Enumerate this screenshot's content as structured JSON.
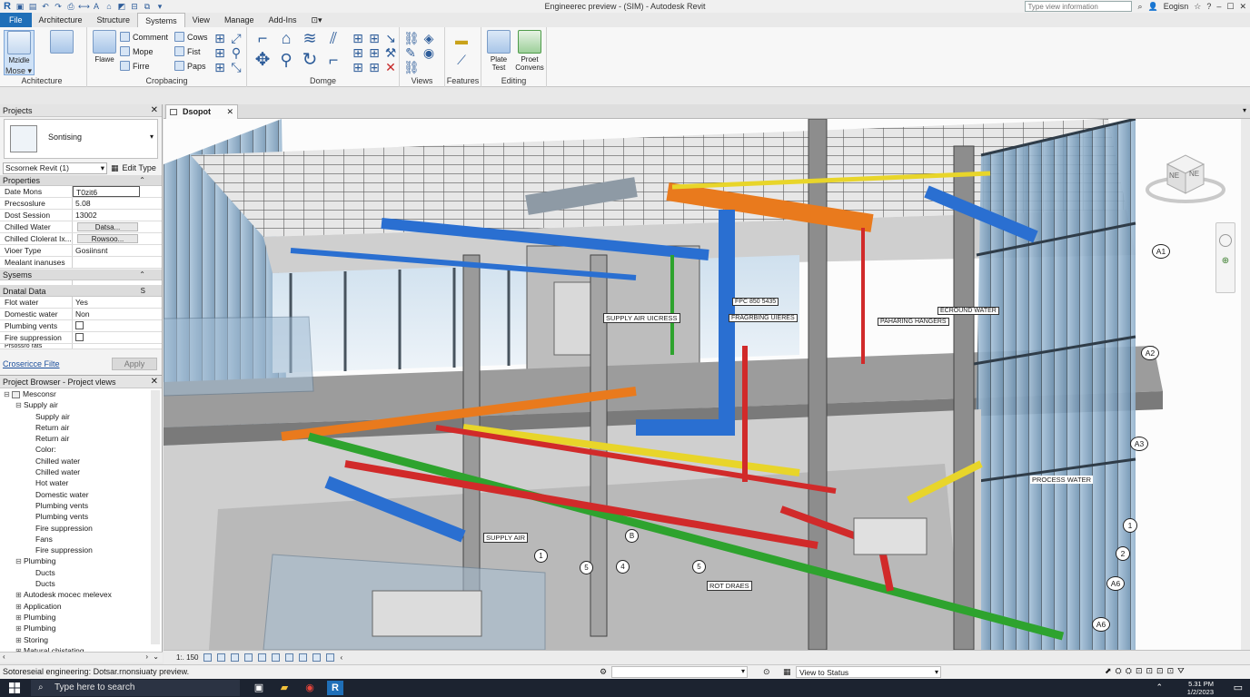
{
  "app": {
    "title": "Engineerec preview - (SIM) - Autodesk Revit",
    "search_placeholder": "Type view information",
    "user": "Eogisn"
  },
  "tabs": [
    "File",
    "Architecture",
    "Structure",
    "Systems",
    "View",
    "Manage",
    "Add-Ins"
  ],
  "active_tab": "Systems",
  "ribbon": {
    "modify": {
      "label": "Mzidle",
      "dropdown": "Mose"
    },
    "architecture": {
      "label": "Achitecture"
    },
    "group1": {
      "flawe": "Flawe",
      "items": [
        "Comment",
        "Mope",
        "Firre"
      ],
      "items2": [
        "Cows",
        "Fist",
        "Paps"
      ],
      "label": "Cropbacing"
    },
    "group2": {
      "label": "Domge"
    },
    "group3": {
      "label": "Views"
    },
    "group4": {
      "label": "Features"
    },
    "group5": {
      "plate_test": "Plate Test",
      "proet_convens": "Proet Convens",
      "label": "Editing"
    }
  },
  "properties": {
    "header": "Projects",
    "type_name": "Sontising",
    "type_selector": "Scsornek Revit (1)",
    "edit_type": "Edit Type",
    "cat1": "Properties",
    "rows1": [
      {
        "k": "Date Mons",
        "v": "T0zit6"
      },
      {
        "k": "Precsoslure",
        "v": "5.08"
      },
      {
        "k": "Dost Session",
        "v": "13002"
      },
      {
        "k": "Chilled Water",
        "v": "Datsa..."
      },
      {
        "k": "Chilled Clolerat Ix...",
        "v": "Rowsoo..."
      },
      {
        "k": "Vioer Type",
        "v": "Gosiinsnt"
      },
      {
        "k": "Mealant inanuses",
        "v": ""
      }
    ],
    "cat2": "Sysems",
    "cat3": "Dnatal Data",
    "rows3": [
      {
        "k": "Flot water",
        "v": "Yes"
      },
      {
        "k": "Domestic water",
        "v": "Non"
      },
      {
        "k": "Plumbing vents",
        "v": ""
      },
      {
        "k": "Fire suppression",
        "v": ""
      },
      {
        "k": "Prsossro rats",
        "v": ""
      }
    ],
    "link": "Crosericce Filte",
    "apply": "Apply"
  },
  "browser": {
    "header": "Project Browser - Project vlews",
    "nodes": [
      {
        "t": "Mesconsr",
        "d": 0,
        "g": "−"
      },
      {
        "t": "Supply air",
        "d": 1,
        "g": "−"
      },
      {
        "t": "Supply air",
        "d": 2,
        "g": ""
      },
      {
        "t": "Return air",
        "d": 2,
        "g": ""
      },
      {
        "t": "Return air",
        "d": 2,
        "g": ""
      },
      {
        "t": "Color:",
        "d": 2,
        "g": ""
      },
      {
        "t": "Chilled water",
        "d": 2,
        "g": ""
      },
      {
        "t": "Chilled water",
        "d": 2,
        "g": ""
      },
      {
        "t": "Hot water",
        "d": 2,
        "g": ""
      },
      {
        "t": "Domestic water",
        "d": 2,
        "g": ""
      },
      {
        "t": "Plumbing vents",
        "d": 2,
        "g": ""
      },
      {
        "t": "Plumbing vents",
        "d": 2,
        "g": ""
      },
      {
        "t": "Fire suppression",
        "d": 2,
        "g": ""
      },
      {
        "t": "Fans",
        "d": 2,
        "g": ""
      },
      {
        "t": "Fire suppression",
        "d": 2,
        "g": ""
      },
      {
        "t": "Plumbing",
        "d": 1,
        "g": "−"
      },
      {
        "t": "Ducts",
        "d": 2,
        "g": ""
      },
      {
        "t": "Ducts",
        "d": 2,
        "g": ""
      },
      {
        "t": "Autodesk mocec melevex",
        "d": 1,
        "g": "+"
      },
      {
        "t": "Application",
        "d": 1,
        "g": "+"
      },
      {
        "t": "Plumbing",
        "d": 1,
        "g": "+"
      },
      {
        "t": "Plumbing",
        "d": 1,
        "g": "+"
      },
      {
        "t": "Storing",
        "d": 1,
        "g": "+"
      },
      {
        "t": "Matural chistating",
        "d": 1,
        "g": "+"
      }
    ]
  },
  "view": {
    "tab": "Dsopot",
    "scale": "1:. 150",
    "viewcube": {
      "left": "NE",
      "right": "NE"
    },
    "tags": {
      "supply_air_upper": "SUPPLY AIR UICRESS",
      "fpc": "FPC 850 5435",
      "plumbing": "FRAGRBING UIERES",
      "plumbing_hangers": "PAHARING HANGERS",
      "ecrond": "ECROUND WATER",
      "process_water": "PROCESS WATER",
      "supply_air_lower": "SUPPLY AIR",
      "roof": "ROT DRAES"
    },
    "grids": [
      "A1",
      "A2",
      "A3",
      "1",
      "2",
      "A6",
      "A6"
    ],
    "level_marks": [
      "1",
      "B",
      "4",
      "5",
      "5"
    ]
  },
  "status": {
    "message": "Sotoreseial engineering: Dotsar.rnonsiuaty preview.",
    "view_to_status": "View to Status"
  },
  "taskbar": {
    "search": "Type here to search",
    "time": "5.31 PM",
    "date": "1/2/2023"
  },
  "colors": {
    "supply_duct": "#2a6fd1",
    "return_duct": "#e97a1d",
    "chilled_water": "#d12a2a",
    "domestic_water": "#2ea32e",
    "hot_water": "#e8d52a",
    "accent": "#1f6fb8"
  }
}
